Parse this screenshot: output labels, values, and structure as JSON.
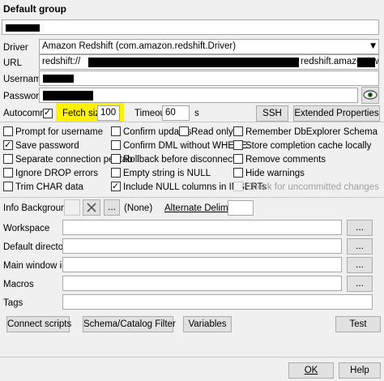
{
  "window": {
    "title": "Default group"
  },
  "profile": {
    "driver_label": "Driver",
    "driver_value": "Amazon Redshift (com.amazon.redshift.Driver)",
    "url_label": "URL",
    "url_prefix": "redshift://",
    "url_visible": "redshift.amazonaws.com",
    "username_label": "Username",
    "password_label": "Password"
  },
  "connection": {
    "autocommit_label": "Autocommit",
    "autocommit_checked": true,
    "fetch_size_label": "Fetch size",
    "fetch_size_value": "100",
    "timeout_label": "Timeout",
    "timeout_value": "60",
    "timeout_unit": "s",
    "ssh_button": "SSH",
    "extended_properties_button": "Extended Properties"
  },
  "options": {
    "col1": [
      {
        "label": "Prompt for username",
        "checked": false
      },
      {
        "label": "Save password",
        "checked": true
      },
      {
        "label": "Separate connection per tab",
        "checked": false
      },
      {
        "label": "Ignore DROP errors",
        "checked": false
      },
      {
        "label": "Trim CHAR data",
        "checked": false
      }
    ],
    "col2": [
      {
        "label": "Confirm updates",
        "checked": false
      },
      {
        "label": "Confirm DML without WHERE",
        "checked": false
      },
      {
        "label": "Rollback before disconnect",
        "checked": false
      },
      {
        "label": "Empty string is NULL",
        "checked": false
      },
      {
        "label": "Include NULL columns in INSERTs",
        "checked": true
      }
    ],
    "read_only": {
      "label": "Read only",
      "checked": false
    },
    "col3": [
      {
        "label": "Remember DbExplorer Schema",
        "checked": false
      },
      {
        "label": "Store completion cache locally",
        "checked": false
      },
      {
        "label": "Remove comments",
        "checked": false
      },
      {
        "label": "Hide warnings",
        "checked": false
      },
      {
        "label": "Check for uncommitted changes",
        "checked": false,
        "disabled": true
      }
    ]
  },
  "info": {
    "info_background_label": "Info Background",
    "color_none_label": "(None)",
    "alternate_delimiter_label": "Alternate Delimiter",
    "workspace_label": "Workspace",
    "default_directory_label": "Default directory",
    "main_window_icon_label": "Main window icon",
    "macros_label": "Macros",
    "tags_label": "Tags",
    "browse_label": "..."
  },
  "buttons": {
    "connect_scripts": "Connect scripts",
    "schema_catalog_filter": "Schema/Catalog Filter",
    "variables": "Variables",
    "test": "Test",
    "ok": "OK",
    "cancel": "Help"
  },
  "icons": {
    "show_password": "eye-icon",
    "clear_color": "x-icon",
    "dropdown": "chevron-down-icon"
  },
  "colors": {
    "highlight": "#fff200",
    "redaction": "#000000"
  }
}
